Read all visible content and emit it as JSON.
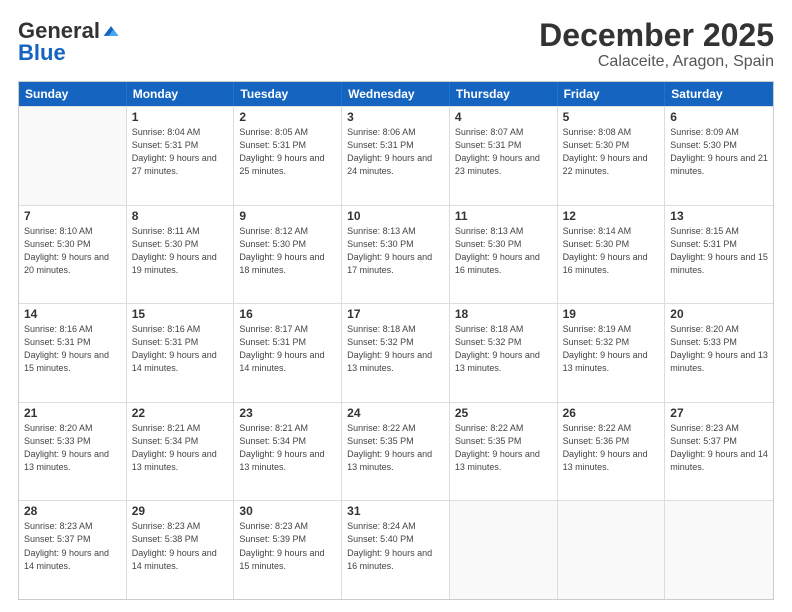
{
  "logo": {
    "general": "General",
    "blue": "Blue",
    "tagline": ""
  },
  "title": "December 2025",
  "subtitle": "Calaceite, Aragon, Spain",
  "headers": [
    "Sunday",
    "Monday",
    "Tuesday",
    "Wednesday",
    "Thursday",
    "Friday",
    "Saturday"
  ],
  "weeks": [
    [
      {
        "day": "",
        "empty": true
      },
      {
        "day": "1",
        "sunrise": "Sunrise: 8:04 AM",
        "sunset": "Sunset: 5:31 PM",
        "daylight": "Daylight: 9 hours and 27 minutes."
      },
      {
        "day": "2",
        "sunrise": "Sunrise: 8:05 AM",
        "sunset": "Sunset: 5:31 PM",
        "daylight": "Daylight: 9 hours and 25 minutes."
      },
      {
        "day": "3",
        "sunrise": "Sunrise: 8:06 AM",
        "sunset": "Sunset: 5:31 PM",
        "daylight": "Daylight: 9 hours and 24 minutes."
      },
      {
        "day": "4",
        "sunrise": "Sunrise: 8:07 AM",
        "sunset": "Sunset: 5:31 PM",
        "daylight": "Daylight: 9 hours and 23 minutes."
      },
      {
        "day": "5",
        "sunrise": "Sunrise: 8:08 AM",
        "sunset": "Sunset: 5:30 PM",
        "daylight": "Daylight: 9 hours and 22 minutes."
      },
      {
        "day": "6",
        "sunrise": "Sunrise: 8:09 AM",
        "sunset": "Sunset: 5:30 PM",
        "daylight": "Daylight: 9 hours and 21 minutes."
      }
    ],
    [
      {
        "day": "7",
        "sunrise": "Sunrise: 8:10 AM",
        "sunset": "Sunset: 5:30 PM",
        "daylight": "Daylight: 9 hours and 20 minutes."
      },
      {
        "day": "8",
        "sunrise": "Sunrise: 8:11 AM",
        "sunset": "Sunset: 5:30 PM",
        "daylight": "Daylight: 9 hours and 19 minutes."
      },
      {
        "day": "9",
        "sunrise": "Sunrise: 8:12 AM",
        "sunset": "Sunset: 5:30 PM",
        "daylight": "Daylight: 9 hours and 18 minutes."
      },
      {
        "day": "10",
        "sunrise": "Sunrise: 8:13 AM",
        "sunset": "Sunset: 5:30 PM",
        "daylight": "Daylight: 9 hours and 17 minutes."
      },
      {
        "day": "11",
        "sunrise": "Sunrise: 8:13 AM",
        "sunset": "Sunset: 5:30 PM",
        "daylight": "Daylight: 9 hours and 16 minutes."
      },
      {
        "day": "12",
        "sunrise": "Sunrise: 8:14 AM",
        "sunset": "Sunset: 5:30 PM",
        "daylight": "Daylight: 9 hours and 16 minutes."
      },
      {
        "day": "13",
        "sunrise": "Sunrise: 8:15 AM",
        "sunset": "Sunset: 5:31 PM",
        "daylight": "Daylight: 9 hours and 15 minutes."
      }
    ],
    [
      {
        "day": "14",
        "sunrise": "Sunrise: 8:16 AM",
        "sunset": "Sunset: 5:31 PM",
        "daylight": "Daylight: 9 hours and 15 minutes."
      },
      {
        "day": "15",
        "sunrise": "Sunrise: 8:16 AM",
        "sunset": "Sunset: 5:31 PM",
        "daylight": "Daylight: 9 hours and 14 minutes."
      },
      {
        "day": "16",
        "sunrise": "Sunrise: 8:17 AM",
        "sunset": "Sunset: 5:31 PM",
        "daylight": "Daylight: 9 hours and 14 minutes."
      },
      {
        "day": "17",
        "sunrise": "Sunrise: 8:18 AM",
        "sunset": "Sunset: 5:32 PM",
        "daylight": "Daylight: 9 hours and 13 minutes."
      },
      {
        "day": "18",
        "sunrise": "Sunrise: 8:18 AM",
        "sunset": "Sunset: 5:32 PM",
        "daylight": "Daylight: 9 hours and 13 minutes."
      },
      {
        "day": "19",
        "sunrise": "Sunrise: 8:19 AM",
        "sunset": "Sunset: 5:32 PM",
        "daylight": "Daylight: 9 hours and 13 minutes."
      },
      {
        "day": "20",
        "sunrise": "Sunrise: 8:20 AM",
        "sunset": "Sunset: 5:33 PM",
        "daylight": "Daylight: 9 hours and 13 minutes."
      }
    ],
    [
      {
        "day": "21",
        "sunrise": "Sunrise: 8:20 AM",
        "sunset": "Sunset: 5:33 PM",
        "daylight": "Daylight: 9 hours and 13 minutes."
      },
      {
        "day": "22",
        "sunrise": "Sunrise: 8:21 AM",
        "sunset": "Sunset: 5:34 PM",
        "daylight": "Daylight: 9 hours and 13 minutes."
      },
      {
        "day": "23",
        "sunrise": "Sunrise: 8:21 AM",
        "sunset": "Sunset: 5:34 PM",
        "daylight": "Daylight: 9 hours and 13 minutes."
      },
      {
        "day": "24",
        "sunrise": "Sunrise: 8:22 AM",
        "sunset": "Sunset: 5:35 PM",
        "daylight": "Daylight: 9 hours and 13 minutes."
      },
      {
        "day": "25",
        "sunrise": "Sunrise: 8:22 AM",
        "sunset": "Sunset: 5:35 PM",
        "daylight": "Daylight: 9 hours and 13 minutes."
      },
      {
        "day": "26",
        "sunrise": "Sunrise: 8:22 AM",
        "sunset": "Sunset: 5:36 PM",
        "daylight": "Daylight: 9 hours and 13 minutes."
      },
      {
        "day": "27",
        "sunrise": "Sunrise: 8:23 AM",
        "sunset": "Sunset: 5:37 PM",
        "daylight": "Daylight: 9 hours and 14 minutes."
      }
    ],
    [
      {
        "day": "28",
        "sunrise": "Sunrise: 8:23 AM",
        "sunset": "Sunset: 5:37 PM",
        "daylight": "Daylight: 9 hours and 14 minutes."
      },
      {
        "day": "29",
        "sunrise": "Sunrise: 8:23 AM",
        "sunset": "Sunset: 5:38 PM",
        "daylight": "Daylight: 9 hours and 14 minutes."
      },
      {
        "day": "30",
        "sunrise": "Sunrise: 8:23 AM",
        "sunset": "Sunset: 5:39 PM",
        "daylight": "Daylight: 9 hours and 15 minutes."
      },
      {
        "day": "31",
        "sunrise": "Sunrise: 8:24 AM",
        "sunset": "Sunset: 5:40 PM",
        "daylight": "Daylight: 9 hours and 16 minutes."
      },
      {
        "day": "",
        "empty": true
      },
      {
        "day": "",
        "empty": true
      },
      {
        "day": "",
        "empty": true
      }
    ]
  ]
}
